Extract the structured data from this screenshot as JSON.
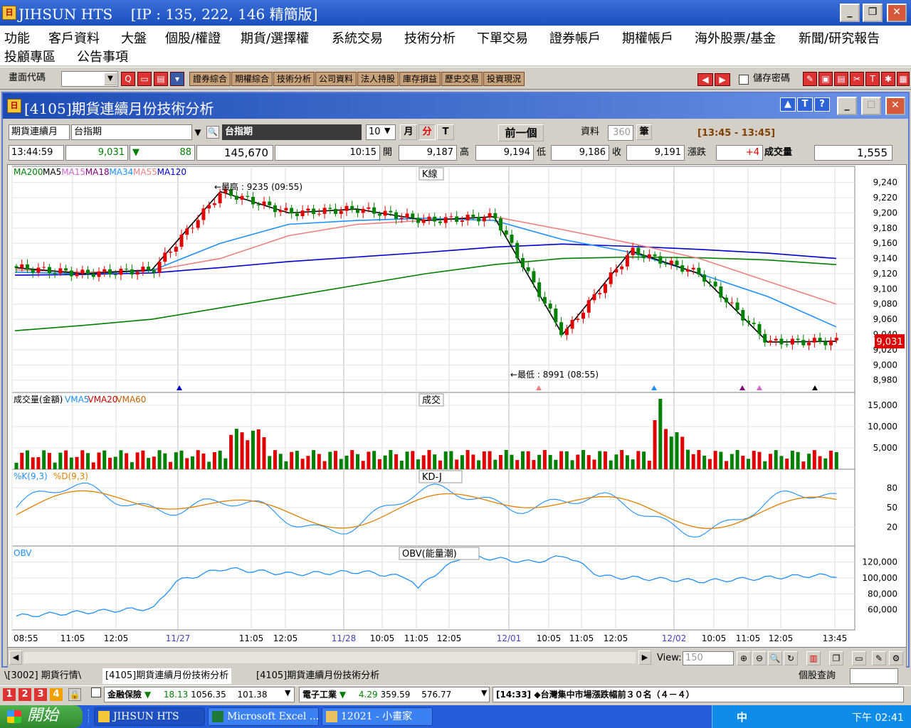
{
  "app": {
    "title": "JIHSUN HTS",
    "ip": "[IP : 135, 222, 146 精簡版]",
    "icon_text": "日"
  },
  "window_buttons": {
    "min": "_",
    "max": "❐",
    "close": "✕"
  },
  "menu": {
    "row1": [
      "功能",
      "客戶資料",
      "大盤",
      "個股/權證",
      "期貨/選擇權",
      "系統交易",
      "技術分析",
      "下單交易",
      "證券帳戶",
      "期權帳戶",
      "海外股票/基金",
      "新聞/研究報告"
    ],
    "row2": [
      "投顧專區",
      "公告事項"
    ]
  },
  "toolbar": {
    "code_label": "畫面代碼",
    "buttons": [
      "證券綜合",
      "期權綜合",
      "技術分析",
      "公司資料",
      "法人持股",
      "庫存損益",
      "歷史交易",
      "投資現況"
    ],
    "save_pwd_label": "儲存密碼"
  },
  "child": {
    "title": "[4105]期貨連續月份技術分析",
    "help": "?",
    "t": "T",
    "up": "▲"
  },
  "controls": {
    "product_type": "期貨連續月",
    "product": "台指期",
    "product_name": "台指期",
    "period": "10",
    "btn_month": "月",
    "btn_min": "分",
    "btn_t": "T",
    "btn_prev": "前一個",
    "data_label": "資料",
    "data_count": "360",
    "data_unit": "筆",
    "time_range": "[13:45 - 13:45]"
  },
  "quote": {
    "time": "13:44:59",
    "price": "9,031",
    "arrow": "▼",
    "change": "88",
    "volume_total": "145,670",
    "t2": "10:15",
    "open_label": "開",
    "open": "9,187",
    "high_label": "高",
    "high": "9,194",
    "low_label": "低",
    "low": "9,186",
    "close_label": "收",
    "close": "9,191",
    "chg_label": "漲跌",
    "chg": "+4",
    "vol_label": "成交量",
    "vol": "1,555"
  },
  "panels": {
    "kline": {
      "tag": "K線",
      "legend": [
        {
          "name": "MA200",
          "color": "#008000"
        },
        {
          "name": "MA5",
          "color": "#000000"
        },
        {
          "name": "MA15",
          "color": "#cc66cc"
        },
        {
          "name": "MA18",
          "color": "#800080"
        },
        {
          "name": "MA34",
          "color": "#1e90ff"
        },
        {
          "name": "MA55",
          "color": "#f08080"
        },
        {
          "name": "MA120",
          "color": "#0000cd"
        }
      ],
      "high_note": "←最高 : 9235 (09:55)",
      "low_note": "←最低 : 8991 (08:55)",
      "last_price": "9,031",
      "yticks": [
        "9,240",
        "9,220",
        "9,200",
        "9,180",
        "9,160",
        "9,140",
        "9,120",
        "9,100",
        "9,080",
        "9,060",
        "9,040",
        "9,020",
        "9,000",
        "8,980"
      ]
    },
    "volume": {
      "tag": "成交",
      "legend": [
        {
          "name": "成交量(金額)",
          "color": "#000000"
        },
        {
          "name": "VMA5",
          "color": "#1e90ff"
        },
        {
          "name": "VMA20",
          "color": "#cc0000"
        },
        {
          "name": "VMA60",
          "color": "#c06000"
        }
      ],
      "yticks": [
        "15,000",
        "10,000",
        "5,000"
      ]
    },
    "kd": {
      "tag": "KD-J",
      "legend": [
        {
          "name": "%K(9,3)",
          "color": "#1e90ff"
        },
        {
          "name": "%D(9,3)",
          "color": "#e08000"
        }
      ],
      "yticks": [
        "80",
        "50",
        "20"
      ]
    },
    "obv": {
      "tag": "OBV(能量潮)",
      "legend": [
        {
          "name": "OBV",
          "color": "#1e90ff"
        }
      ],
      "yticks": [
        "120,000",
        "100,000",
        "80,000",
        "60,000"
      ]
    }
  },
  "xaxis": [
    "08:55",
    "11:05",
    "12:05",
    "11/27",
    "11:05",
    "12:05",
    "11/28",
    "10:05",
    "11:05",
    "12:05",
    "12/01",
    "10:05",
    "11:05",
    "12:05",
    "12/02",
    "10:05",
    "11:05",
    "12:05",
    "13:45"
  ],
  "scroll": {
    "view_label": "View:",
    "view_value": "150"
  },
  "tabs": [
    "\\[3002] 期貨行情\\",
    "[4105]期貨連續月份技術分析",
    "[4105]期貨連續月份技術分析"
  ],
  "stock_query": "個股查詢",
  "ticker": {
    "nums": [
      "1",
      "2",
      "3",
      "4"
    ],
    "g1_name": "金融保險",
    "g1_v1": "18.13",
    "g1_v2": "1056.35",
    "g1_v3": "101.38",
    "g2_name": "電子工業",
    "g2_v1": "4.29",
    "g2_v2": "359.59",
    "g2_v3": "576.77",
    "news": "[14:33] ◆台灣集中市場漲跌幅前３０名（４－４）"
  },
  "taskbar": {
    "start": "開始",
    "items": [
      "JIHSUN HTS",
      "Microsoft Excel ...",
      "12021 - 小畫家"
    ],
    "clock": "下午 02:41",
    "ime": "中"
  },
  "chart_data": {
    "type": "candlestick",
    "title": "K線",
    "xlabel": "",
    "ylabel": "",
    "ylim": [
      8975,
      9250
    ],
    "x_range": [
      "11/26 08:55",
      "12/02 13:45"
    ],
    "high": {
      "value": 9235,
      "time": "09:55"
    },
    "low": {
      "value": 8991,
      "time": "08:55"
    },
    "last": 9031,
    "ma_lines": {
      "MA200": [
        9045,
        9052,
        9060,
        9075,
        9090,
        9105,
        9120,
        9132,
        9140,
        9142,
        9141,
        9138,
        9132
      ],
      "MA120": [
        9118,
        9119,
        9121,
        9128,
        9136,
        9142,
        9148,
        9155,
        9159,
        9156,
        9152,
        9147,
        9140
      ],
      "MA55": [
        9125,
        9122,
        9124,
        9140,
        9170,
        9185,
        9190,
        9195,
        9178,
        9160,
        9140,
        9110,
        9080
      ],
      "MA34": [
        9122,
        9120,
        9124,
        9160,
        9185,
        9190,
        9193,
        9190,
        9165,
        9148,
        9120,
        9090,
        9050
      ],
      "MA5": [
        9128,
        9120,
        9125,
        9228,
        9200,
        9205,
        9190,
        9195,
        9040,
        9150,
        9120,
        9030,
        9031
      ]
    },
    "volume": {
      "ylim": [
        0,
        17000
      ],
      "peak": 16500
    },
    "kd": {
      "ylim": [
        0,
        100
      ],
      "K_last": 65,
      "D_last": 52
    },
    "obv": {
      "ylim": [
        40000,
        135000
      ],
      "last": 110000
    }
  }
}
